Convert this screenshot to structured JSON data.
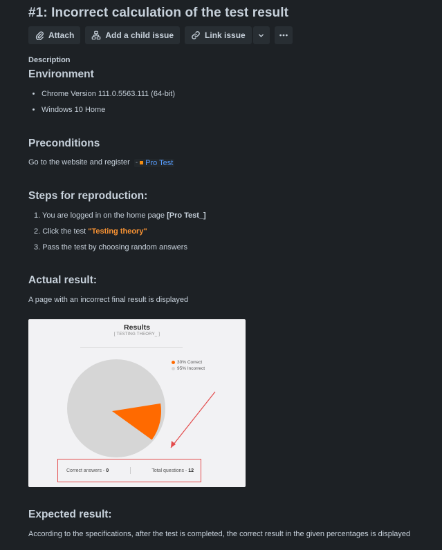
{
  "issue": {
    "title": "#1: Incorrect calculation of the test result"
  },
  "toolbar": {
    "attach_label": "Attach",
    "child_issue_label": "Add a child issue",
    "link_issue_label": "Link issue"
  },
  "description": {
    "label": "Description",
    "environment": {
      "heading": "Environment",
      "items": [
        "Chrome Version 111.0.5563.111 (64-bit)",
        "Windows 10 Home"
      ]
    },
    "preconditions": {
      "heading": "Preconditions",
      "text": "Go to the website and register",
      "link_dash": "-",
      "link_text": "Pro Test"
    },
    "steps": {
      "heading": "Steps for reproduction:",
      "items": [
        {
          "prefix": "1. You are logged in on the home page ",
          "bold": "[Pro Test_]"
        },
        {
          "prefix": "2. Click the test ",
          "orange": "\"Testing theory\""
        },
        {
          "prefix": "3. Pass the test by choosing random answers"
        }
      ]
    },
    "actual": {
      "heading": "Actual result:",
      "text": "A page with an incorrect final result is displayed"
    },
    "screenshot": {
      "title": "Results",
      "subtitle": "[ TESTING THEORY_ ]",
      "legend": [
        {
          "label": "30% Correct",
          "color": "#ff6a00"
        },
        {
          "label": "95% Incorrect",
          "color": "#d6d6d6"
        }
      ],
      "correct_label": "Correct answers - ",
      "correct_value": "0",
      "total_label": "Total questions - ",
      "total_value": "12",
      "pie_fractions": {
        "correct": 0.3,
        "incorrect": 0.95
      }
    },
    "expected": {
      "heading": "Expected result:",
      "text": "According to the specifications, after the test is completed, the correct result in the given percentages is displayed"
    }
  },
  "colors": {
    "background": "#1d2125",
    "text": "#c7d1db",
    "link": "#579dff",
    "accent_orange": "#f79233",
    "annotation_red": "#e34b4b"
  }
}
